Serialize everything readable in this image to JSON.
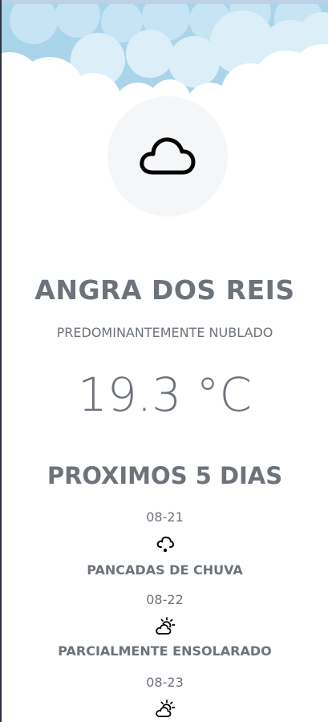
{
  "weather": {
    "city": "ANGRA DOS REIS",
    "condition": "PREDOMINANTEMENTE NUBLADO",
    "temperature": "19.3 °C",
    "main_icon": "cloud-icon"
  },
  "forecast": {
    "title": "PROXIMOS 5 DIAS",
    "days": [
      {
        "date": "08-21",
        "icon": "cloud-rain-icon",
        "label": "PANCADAS DE CHUVA"
      },
      {
        "date": "08-22",
        "icon": "partly-sunny-icon",
        "label": "PARCIALMENTE ENSOLARADO"
      },
      {
        "date": "08-23",
        "icon": "partly-sunny-icon",
        "label": ""
      }
    ]
  },
  "colors": {
    "text": "#6c737a",
    "sky": "#a9d4ea",
    "icon_bg": "#f4f6f8"
  }
}
